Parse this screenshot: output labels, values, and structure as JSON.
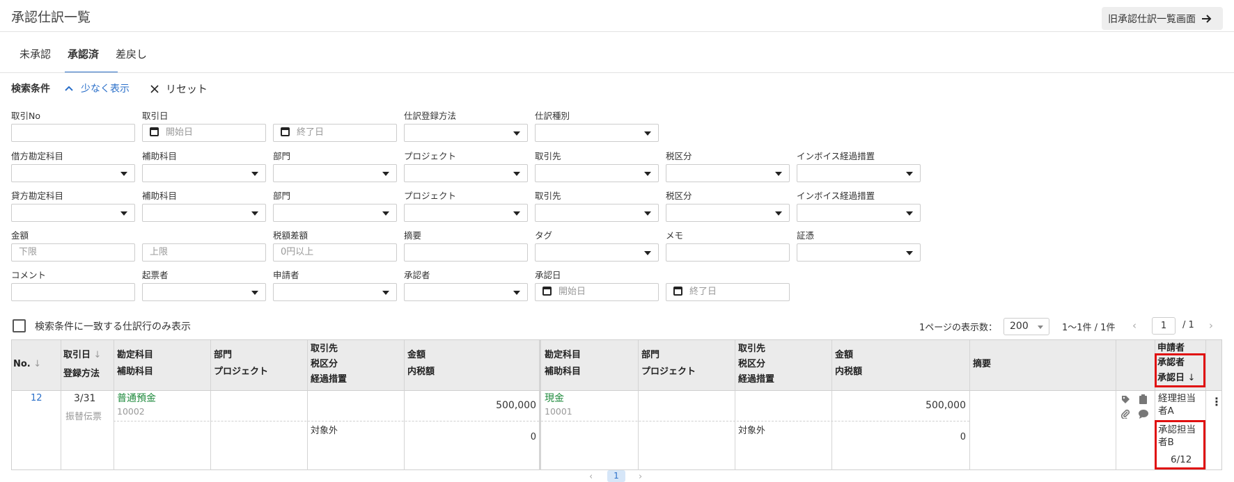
{
  "header": {
    "title": "承認仕訳一覧",
    "old_button_label": "旧承認仕訳一覧画面"
  },
  "tabs": [
    {
      "label": "未承認"
    },
    {
      "label": "承認済",
      "active": true
    },
    {
      "label": "差戻し"
    }
  ],
  "search": {
    "title": "検索条件",
    "less_label": "少なく表示",
    "reset_label": "リセット",
    "labels": {
      "torihiki_no": "取引No",
      "torihiki_date": "取引日",
      "register_method": "仕訳登録方法",
      "journal_type": "仕訳種別",
      "debit_account": "借方勘定科目",
      "sub_account": "補助科目",
      "department": "部門",
      "project": "プロジェクト",
      "partner": "取引先",
      "tax_class": "税区分",
      "invoice": "インボイス経過措置",
      "credit_account": "貸方勘定科目",
      "amount": "金額",
      "tax_diff": "税額差額",
      "summary": "摘要",
      "tag": "タグ",
      "memo": "メモ",
      "evidence": "証憑",
      "comment": "コメント",
      "drafter": "起票者",
      "applicant": "申請者",
      "approver": "承認者",
      "approval_date": "承認日"
    },
    "placeholders": {
      "start_date": "開始日",
      "end_date": "終了日",
      "lower": "下限",
      "upper": "上限",
      "tax_diff": "0円以上"
    }
  },
  "toolbar": {
    "only_matching_label": "検索条件に一致する仕訳行のみ表示",
    "per_page_label": "1ページの表示数：",
    "per_page_value": "200",
    "range_text": "1〜1件 / 1件",
    "page_current": "1",
    "page_total": "/  1"
  },
  "table": {
    "headers": {
      "no": "No.",
      "date": "取引日",
      "method": "登録方法",
      "account": "勘定科目",
      "sub_account": "補助科目",
      "department": "部門",
      "project": "プロジェクト",
      "partner": "取引先",
      "tax_class": "税区分",
      "transition": "経過措置",
      "amount": "金額",
      "tax_included": "内税額",
      "summary": "摘要",
      "applicant": "申請者",
      "approver": "承認者",
      "approval_date": "承認日"
    },
    "sort_arrow": "↓",
    "row": {
      "no": "12",
      "date": "3/31",
      "method": "振替伝票",
      "debit_account": "普通預金",
      "debit_code": "10002",
      "debit_amount": "500,000",
      "debit_tax_class": "対象外",
      "debit_tax": "0",
      "credit_account": "現金",
      "credit_code": "10001",
      "credit_amount": "500,000",
      "credit_tax_class": "対象外",
      "credit_tax": "0",
      "applicant_line1": "経理担当",
      "applicant_line2": "者A",
      "approver_line1": "承認担当",
      "approver_line2": "者B",
      "approval_date": "6/12"
    }
  },
  "pagination_bottom": {
    "current": "1"
  }
}
